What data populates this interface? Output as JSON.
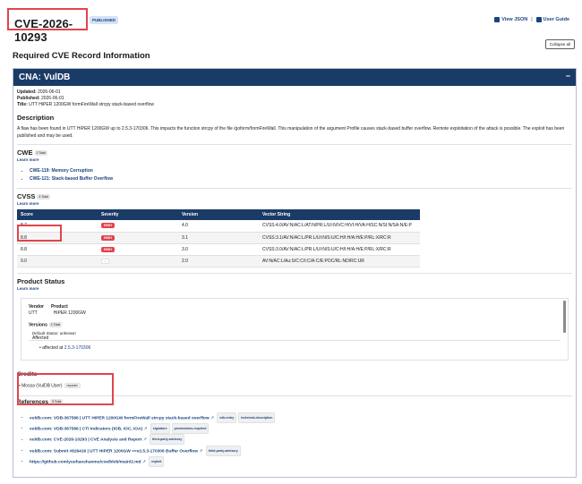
{
  "header": {
    "cve_id": "CVE-2026-10293",
    "status_badge": "PUBLISHED",
    "view_json": "View JSON",
    "separator": "|",
    "user_guide": "User Guide",
    "collapse_all": "Collapse all"
  },
  "section_title": "Required CVE Record Information",
  "cna": {
    "title": "CNA: VulDB",
    "collapse_symbol": "−",
    "updated_label": "Updated:",
    "updated": "2026-06-01",
    "published_label": "Published:",
    "published": "2026-06-01",
    "title_label": "Title:",
    "title_value": "UTT HiPER 1200GW formFireWall strcpy stack-based overflow"
  },
  "description": {
    "heading": "Description",
    "text": "A flaw has been found in UTT HiPER 1200GW up to 2.5.3-170306. This impacts the function strcpy of the file /goform/formFireWall. This manipulation of the argument Profile causes stack-based buffer overflow. Remote exploitation of the attack is possible. The exploit has been published and may be used."
  },
  "cwe": {
    "heading": "CWE",
    "count": "2 Total",
    "learn_more": "Learn more",
    "items": [
      "CWE-119: Memory Corruption",
      "CWE-121: Stack-based Buffer Overflow"
    ]
  },
  "cvss": {
    "heading": "CVSS",
    "count": "4 Total",
    "learn_more": "Learn more",
    "columns": [
      "Score",
      "Severity",
      "Version",
      "Vector String"
    ],
    "rows": [
      {
        "score": "8.7",
        "severity": "HIGH",
        "version": "4.0",
        "vector": "CVSS:4.0/AV:N/AC:L/AT:N/PR:L/UI:N/VC:H/VI:H/VA:H/SC:N/SI:N/SA:N/E:P"
      },
      {
        "score": "8.8",
        "severity": "HIGH",
        "version": "3.1",
        "vector": "CVSS:3.1/AV:N/AC:L/PR:L/UI:N/S:U/C:H/I:H/A:H/E:P/RL:X/RC:R"
      },
      {
        "score": "8.8",
        "severity": "HIGH",
        "version": "3.0",
        "vector": "CVSS:3.0/AV:N/AC:L/PR:L/UI:N/S:U/C:H/I:H/A:H/E:P/RL:X/RC:R"
      },
      {
        "score": "9.0",
        "severity": "-",
        "version": "2.0",
        "vector": "AV:N/AC:L/Au:S/C:C/I:C/A:C/E:POC/RL:ND/RC:UR"
      }
    ]
  },
  "product_status": {
    "heading": "Product Status",
    "learn_more": "Learn more",
    "vendor_label": "Vendor",
    "product_label": "Product",
    "vendor": "UTT",
    "product": "HiPER 1200GW",
    "versions_label": "Versions",
    "versions_count": "1 Total",
    "default_status": "Default Status: unknown",
    "affected_label": "Affected",
    "affected_prefix": "affected at",
    "affected_version": "2.5.3-170306"
  },
  "credits": {
    "heading": "Credits",
    "name": "Mossa (VulDB User)",
    "role": "reporter"
  },
  "references": {
    "heading": "References",
    "count": "5 Total",
    "items": [
      {
        "text": "vuldb.com: VDB-367586 | UTT HiPER 1200GW formFireWall strcpy stack-based overflow",
        "tags": [
          "vdb-entry",
          "technical-description"
        ]
      },
      {
        "text": "vuldb.com: VDB-367586 | CTI Indicators (IOB, IOC, IOA)",
        "tags": [
          "signature",
          "permissions-required"
        ]
      },
      {
        "text": "vuldb.com: CVE-2026-10293 | CVE Analysis and Report",
        "tags": [
          "third-party-advisory"
        ]
      },
      {
        "text": "vuldb.com: Submit #826416 | UTT HiPER 1200GW <=v2.5.3-170306 Buffer Overflow",
        "tags": [
          "third-party-advisory"
        ]
      },
      {
        "text": "https://github.com/yuuhaoshanmu/cve/blob/main/2.md",
        "tags": [
          "exploit"
        ]
      }
    ]
  }
}
